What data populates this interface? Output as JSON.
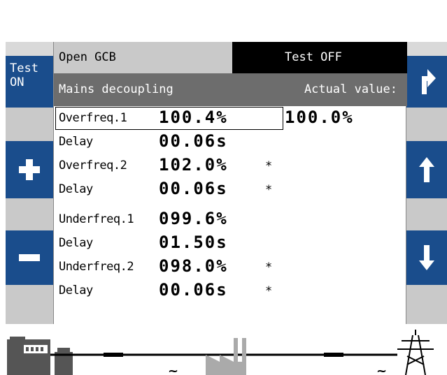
{
  "header": {
    "mode_label": "Open GCB",
    "test_status": "Test OFF"
  },
  "subheader": {
    "title": "Mains decoupling",
    "actual_label": "Actual value:"
  },
  "left_buttons": {
    "test_label_line1": "Test",
    "test_label_line2": "ON",
    "plus_icon": "plus-icon",
    "minus_icon": "minus-icon"
  },
  "right_buttons": {
    "up_right_icon": "arrow-up-right-icon",
    "up_icon": "arrow-up-icon",
    "down_icon": "arrow-down-icon"
  },
  "rows": [
    {
      "label": "Overfreq.1",
      "value": "100.4%",
      "star": "",
      "actual": "100.0%"
    },
    {
      "label": "Delay",
      "value": "00.06s",
      "star": "",
      "actual": ""
    },
    {
      "label": "Overfreq.2",
      "value": "102.0%",
      "star": "*",
      "actual": ""
    },
    {
      "label": "Delay",
      "value": "00.06s",
      "star": "*",
      "actual": ""
    },
    {
      "label": "Underfreq.1",
      "value": "099.6%",
      "star": "",
      "actual": ""
    },
    {
      "label": "Delay",
      "value": "01.50s",
      "star": "",
      "actual": ""
    },
    {
      "label": "Underfreq.2",
      "value": "098.0%",
      "star": "*",
      "actual": ""
    },
    {
      "label": "Delay",
      "value": "00.06s",
      "star": "*",
      "actual": ""
    }
  ],
  "colors": {
    "button_blue": "#1a4d8c",
    "button_grey": "#c9c9c9",
    "header_dark": "#6d6d6d"
  }
}
